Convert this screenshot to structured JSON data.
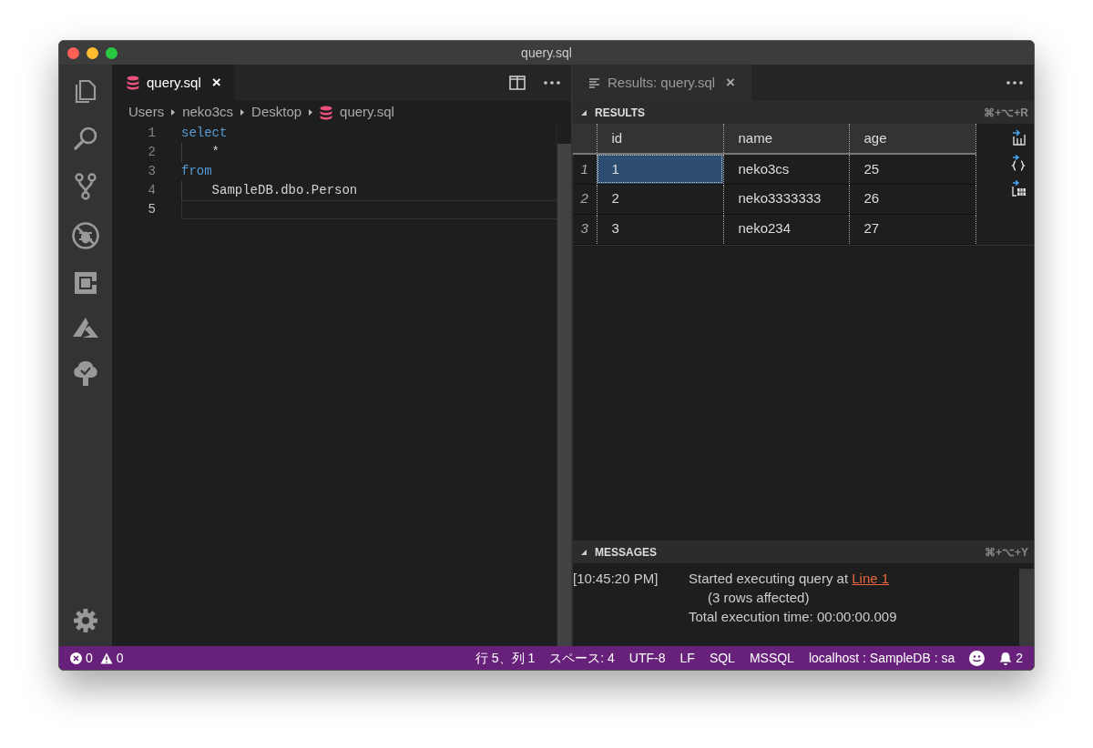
{
  "window": {
    "title": "query.sql"
  },
  "editor": {
    "tab": {
      "label": "query.sql",
      "close": "×",
      "selected": true
    },
    "breadcrumb": [
      "Users",
      "neko3cs",
      "Desktop",
      "query.sql"
    ],
    "lines": [
      {
        "number": "1",
        "text": "select",
        "kind": "keyword",
        "current": false
      },
      {
        "number": "2",
        "text": "    *",
        "kind": "plain",
        "current": false
      },
      {
        "number": "3",
        "text": "from",
        "kind": "keyword",
        "current": false
      },
      {
        "number": "4",
        "text": "    SampleDB.dbo.Person",
        "kind": "plain",
        "current": false
      },
      {
        "number": "5",
        "kind": "plain",
        "current": true
      }
    ]
  },
  "results_tab": {
    "label": "Results: query.sql",
    "close": "×"
  },
  "results": {
    "title": "RESULTS",
    "shortcut": "⌘+⌥+R",
    "expanded": true,
    "table": {
      "columns": [
        "id",
        "name",
        "age"
      ],
      "rows": [
        {
          "number": "1",
          "cells": [
            {
              "text": "1",
              "selected": true
            },
            {
              "text": "neko3cs",
              "selected": false
            },
            {
              "text": "25",
              "selected": false
            }
          ]
        },
        {
          "number": "2",
          "cells": [
            {
              "text": "2",
              "selected": false
            },
            {
              "text": "neko3333333",
              "selected": false
            },
            {
              "text": "26",
              "selected": false
            }
          ]
        },
        {
          "number": "3",
          "cells": [
            {
              "text": "3",
              "selected": false
            },
            {
              "text": "neko234",
              "selected": false
            },
            {
              "text": "27",
              "selected": false
            }
          ]
        }
      ]
    }
  },
  "messages": {
    "title": "MESSAGES",
    "shortcut": "⌘+⌥+Y",
    "expanded": true,
    "time": "[10:45:20 PM]",
    "text": "Started executing query at ",
    "link": "Line 1",
    "lines": [
      {
        "text": "(3 rows affected)",
        "indented": true
      },
      {
        "text": "Total execution time: 00:00:00.009",
        "indented": false
      }
    ]
  },
  "status_bar": {
    "errors": "0",
    "warnings": "0",
    "items": [
      "行 5、列 1",
      "スペース: 4",
      "UTF-8",
      "LF",
      "SQL",
      "MSSQL",
      "localhost : SampleDB : sa"
    ],
    "notifications": "2"
  }
}
